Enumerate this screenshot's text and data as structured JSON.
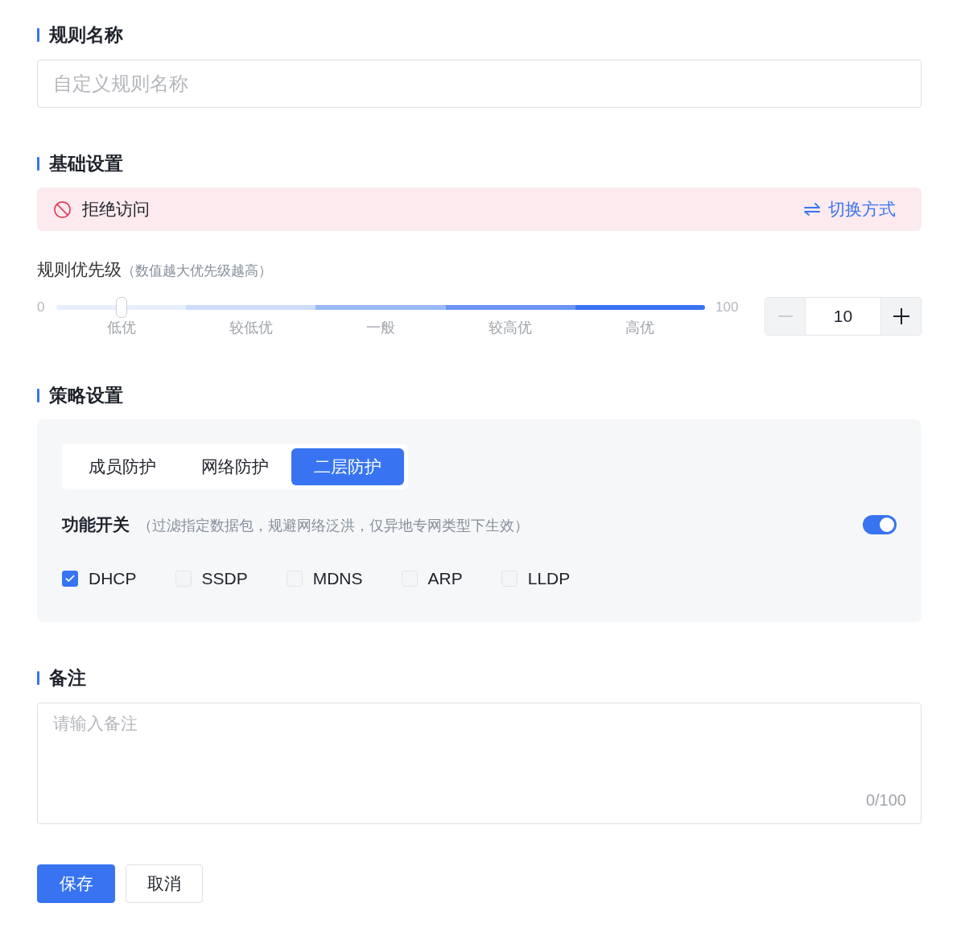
{
  "rule_name": {
    "title": "规则名称",
    "placeholder": "自定义规则名称"
  },
  "basic_settings": {
    "title": "基础设置",
    "action_banner": {
      "label": "拒绝访问",
      "switch_link": "切换方式"
    },
    "priority": {
      "label": "规则优先级",
      "hint": "（数值越大优先级越高）",
      "slider": {
        "min_label": "0",
        "max_label": "100",
        "level": 0.1,
        "segments": [
          {
            "label": "低优",
            "color": "#e8effc"
          },
          {
            "label": "较低优",
            "color": "#ccdcfb"
          },
          {
            "label": "一般",
            "color": "#99b8f8"
          },
          {
            "label": "较高优",
            "color": "#6a95f5"
          },
          {
            "label": "高优",
            "color": "#3874f2"
          }
        ]
      },
      "stepper": {
        "value": "10",
        "decrement_disabled": true
      }
    }
  },
  "policy_settings": {
    "title": "策略设置",
    "tabs": [
      {
        "label": "成员防护",
        "selected": false
      },
      {
        "label": "网络防护",
        "selected": false
      },
      {
        "label": "二层防护",
        "selected": true
      }
    ],
    "feature_switch": {
      "label": "功能开关",
      "hint": "（过滤指定数据包，规避网络泛洪，仅异地专网类型下生效）",
      "on": true
    },
    "protocols": [
      {
        "label": "DHCP",
        "checked": true
      },
      {
        "label": "SSDP",
        "checked": false
      },
      {
        "label": "MDNS",
        "checked": false
      },
      {
        "label": "ARP",
        "checked": false
      },
      {
        "label": "LLDP",
        "checked": false
      }
    ]
  },
  "remarks": {
    "title": "备注",
    "placeholder": "请输入备注",
    "counter": "0/100"
  },
  "buttons": [
    {
      "label": "保存",
      "kind": "primary"
    },
    {
      "label": "取消",
      "kind": "default"
    }
  ]
}
